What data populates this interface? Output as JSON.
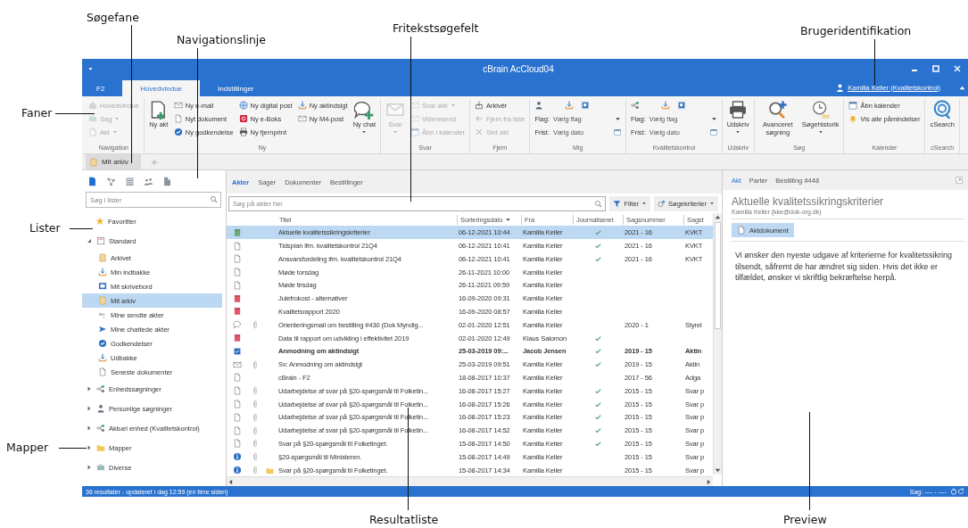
{
  "annotations": [
    {
      "label": "Søgefane"
    },
    {
      "label": "Navigationslinje"
    },
    {
      "label": "Fritekstsøgefelt"
    },
    {
      "label": "Brugeridentifikation"
    },
    {
      "label": "Faner"
    },
    {
      "label": "Lister"
    },
    {
      "label": "Mapper"
    },
    {
      "label": "Resultatliste"
    },
    {
      "label": "Preview"
    }
  ],
  "window": {
    "title": "cBrain AcCloud04"
  },
  "tabs": [
    {
      "label": "F2",
      "selected": false
    },
    {
      "label": "Hovedvindue",
      "selected": true
    },
    {
      "label": "Indstillinger",
      "selected": false
    }
  ],
  "user": {
    "label": "Kamilla Keller (Kvalitetskontrol)"
  },
  "ribbon": {
    "groups": [
      {
        "label": "Navigation",
        "columns": [
          [
            {
              "kind": "small",
              "label": "Hovedvindue",
              "disabled": true,
              "dropdown": false
            },
            {
              "kind": "small",
              "label": "Sag",
              "disabled": true,
              "dropdown": true
            },
            {
              "kind": "small",
              "label": "Akt",
              "disabled": true,
              "dropdown": true
            }
          ]
        ]
      },
      {
        "label": "Ny",
        "columns": [
          [
            {
              "kind": "large",
              "label": "Ny akt",
              "disabled": false,
              "dropdown": false
            }
          ],
          [
            {
              "kind": "small",
              "label": "Ny e-mail",
              "disabled": false,
              "dropdown": false
            },
            {
              "kind": "small",
              "label": "Nyt dokument",
              "disabled": false,
              "dropdown": false
            },
            {
              "kind": "small",
              "label": "Ny godkendelse",
              "disabled": false,
              "dropdown": false
            }
          ],
          [
            {
              "kind": "small",
              "label": "Ny digital post",
              "disabled": false,
              "dropdown": false
            },
            {
              "kind": "small",
              "label": "Ny e-Boks",
              "disabled": false,
              "dropdown": false
            },
            {
              "kind": "small",
              "label": "Ny fjernprint",
              "disabled": false,
              "dropdown": false
            }
          ],
          [
            {
              "kind": "small",
              "label": "Ny aktindsigt",
              "disabled": false,
              "dropdown": false
            },
            {
              "kind": "small",
              "label": "Ny M4-post",
              "disabled": false,
              "dropdown": false
            }
          ],
          [
            {
              "kind": "large",
              "label": "Ny chat",
              "disabled": false,
              "dropdown": true
            }
          ]
        ]
      },
      {
        "label": "Svar",
        "columns": [
          [
            {
              "kind": "large",
              "label": "Svar",
              "disabled": true,
              "dropdown": true
            }
          ],
          [
            {
              "kind": "small",
              "label": "Svar alle",
              "disabled": true,
              "dropdown": true
            },
            {
              "kind": "small",
              "label": "Videresend",
              "disabled": true,
              "dropdown": false
            },
            {
              "kind": "small",
              "label": "Åbn i kalender",
              "disabled": true,
              "dropdown": false
            }
          ]
        ]
      },
      {
        "label": "Fjern",
        "columns": [
          [
            {
              "kind": "small",
              "label": "Arkivér",
              "disabled": false,
              "dropdown": false
            },
            {
              "kind": "small",
              "label": "Fjern fra liste",
              "disabled": true,
              "dropdown": false
            },
            {
              "kind": "small",
              "label": "Slet akt",
              "disabled": true,
              "dropdown": false
            }
          ]
        ]
      },
      {
        "label": "Mig",
        "columns": [
          [
            {
              "kind": "icons"
            },
            {
              "kind": "dropdown-field",
              "label": "Flag:",
              "value": "Vælg flag"
            },
            {
              "kind": "date-field",
              "label": "Frist:",
              "value": "Vælg dato"
            }
          ]
        ]
      },
      {
        "label": "Kvalitetskontrol",
        "columns": [
          [
            {
              "kind": "icons"
            },
            {
              "kind": "dropdown-field",
              "label": "Flag:",
              "value": "Vælg flag"
            },
            {
              "kind": "date-field",
              "label": "Frist:",
              "value": "Vælg dato"
            }
          ]
        ]
      },
      {
        "label": "Udskriv",
        "columns": [
          [
            {
              "kind": "large",
              "label": "Udskriv",
              "disabled": false,
              "dropdown": true
            }
          ]
        ]
      },
      {
        "label": "Søg",
        "columns": [
          [
            {
              "kind": "large",
              "label": "Avanceret søgning",
              "disabled": false,
              "dropdown": false
            }
          ],
          [
            {
              "kind": "large",
              "label": "Søgehistorik",
              "disabled": false,
              "dropdown": true
            }
          ]
        ]
      },
      {
        "label": "Kalender",
        "columns": [
          [
            {
              "kind": "small",
              "label": "Åbn kalender",
              "disabled": false,
              "dropdown": false
            },
            {
              "kind": "small",
              "label": "Vis alle påmindelser",
              "disabled": false,
              "dropdown": false
            }
          ]
        ]
      },
      {
        "label": "cSearch",
        "columns": [
          [
            {
              "kind": "large",
              "label": "cSearch",
              "disabled": false,
              "dropdown": false
            }
          ]
        ]
      }
    ]
  },
  "doc_tabs": [
    {
      "label": "Mit arkiv",
      "selected": true
    }
  ],
  "sidebar": {
    "tools": [
      {
        "selected": true
      },
      {
        "selected": false
      },
      {
        "selected": false
      },
      {
        "selected": false
      },
      {
        "selected": false
      }
    ],
    "search": {
      "placeholder": "Søg i lister"
    },
    "items": [
      {
        "label": "Favoritter",
        "selected": false
      },
      {
        "label": "Standard",
        "selected": false,
        "expanded": true,
        "children": [
          {
            "label": "Arkivet",
            "selected": false
          },
          {
            "label": "Min indbakke",
            "selected": false
          },
          {
            "label": "Mit skrivebord",
            "selected": false
          },
          {
            "label": "Mit arkiv",
            "selected": true
          },
          {
            "label": "Mine sendte akter",
            "selected": false
          },
          {
            "label": "Mine chattede akter",
            "selected": false
          },
          {
            "label": "Godkendelser",
            "selected": false
          },
          {
            "label": "Udbakke",
            "selected": false
          },
          {
            "label": "Seneste dokumenter",
            "selected": false
          }
        ]
      },
      {
        "label": "Enhedssøgninger",
        "selected": false,
        "expanded": false
      },
      {
        "label": "Personlige søgninger",
        "selected": false,
        "expanded": false
      },
      {
        "label": "Aktuel enhed (Kvalitetskontrol)",
        "selected": false,
        "expanded": false
      },
      {
        "label": "Mapper",
        "selected": false,
        "expanded": false
      },
      {
        "label": "Diverse",
        "selected": false,
        "expanded": false
      }
    ]
  },
  "list": {
    "tabs": [
      {
        "label": "Akter",
        "selected": true
      },
      {
        "label": "Sager",
        "selected": false
      },
      {
        "label": "Dokumenter",
        "selected": false
      },
      {
        "label": "Bestillinger",
        "selected": false
      }
    ],
    "search": {
      "placeholder": "Søg på akter her"
    },
    "filter": "Filter",
    "criteria": "Søgekriterier",
    "columns": [
      {
        "label": "Titel",
        "sorted": false
      },
      {
        "label": "Sorteringsdato",
        "sorted": true
      },
      {
        "label": "Fra",
        "sorted": false
      },
      {
        "label": "Journaliseret",
        "sorted": false
      },
      {
        "label": "Sagsnummer",
        "sorted": false
      },
      {
        "label": "Sagst",
        "sorted": false
      }
    ],
    "rows": [
      {
        "kind": "note",
        "attachment": false,
        "folder": false,
        "title": "Aktuelle kvalitetssikringskriterier",
        "date": "06-12-2021 10:44",
        "from": "Kamilla Keller",
        "journalized": true,
        "case_number": "2021 - 16",
        "case_title": "KVKT",
        "bold": false,
        "selected": true
      },
      {
        "kind": "document",
        "attachment": false,
        "folder": false,
        "title": "Tidsplan ifm. kvalitetskontrol 21Q4",
        "date": "06-12-2021 10:41",
        "from": "Kamilla Keller",
        "journalized": true,
        "case_number": "2021 - 16",
        "case_title": "KVKT",
        "bold": false,
        "selected": false
      },
      {
        "kind": "document",
        "attachment": false,
        "folder": false,
        "title": "Ansvarsfordeling ifm. kvalitetskontrol 21Q4",
        "date": "06-12-2021 10:41",
        "from": "Kamilla Keller",
        "journalized": true,
        "case_number": "2021 - 16",
        "case_title": "KVKT",
        "bold": false,
        "selected": false
      },
      {
        "kind": "document",
        "attachment": false,
        "folder": false,
        "title": "Møde torsdag",
        "date": "26-11-2021 10:00",
        "from": "Kamilla Keller",
        "journalized": false,
        "bold": false,
        "selected": false
      },
      {
        "kind": "document",
        "attachment": false,
        "folder": false,
        "title": "Møde tirsdag",
        "date": "26-11-2021 09:59",
        "from": "Kamilla Keller",
        "journalized": false,
        "bold": false,
        "selected": false
      },
      {
        "kind": "calendar",
        "attachment": false,
        "folder": false,
        "title": "Julefrokost - alternativer",
        "date": "16-09-2020 09:31",
        "from": "Kamilla Keller",
        "journalized": false,
        "bold": false,
        "selected": false
      },
      {
        "kind": "calendar",
        "attachment": false,
        "folder": false,
        "title": "Kvalitetsrapport 2020",
        "date": "16-09-2020 08:57",
        "from": "Kamilla Keller",
        "journalized": false,
        "bold": false,
        "selected": false
      },
      {
        "kind": "chat",
        "attachment": true,
        "folder": false,
        "title": "Orienteringsmail om bestilling #430 (Dok Myndig...",
        "date": "02-01-2020 12:51",
        "from": "Kamilla Keller",
        "journalized": false,
        "case_number": "2020 - 1",
        "case_title": "Styrel",
        "bold": false,
        "selected": false
      },
      {
        "kind": "calendar",
        "attachment": false,
        "folder": false,
        "title": "Data til rapport om udvikling i effektivitet 2019",
        "date": "02-01-2020 12:49",
        "from": "Klaus Salomon",
        "journalized": true,
        "bold": false,
        "selected": false
      },
      {
        "kind": "task",
        "attachment": false,
        "folder": false,
        "title": "Anmodning om aktindsigt",
        "date": "25-03-2019 09:...",
        "from": "Jacob Jensen",
        "journalized": true,
        "case_number": "2019 - 15",
        "case_title": "Aktin",
        "bold": true,
        "selected": false
      },
      {
        "kind": "mail",
        "attachment": true,
        "folder": false,
        "title": "Sv: Anmodning om aktindsigt",
        "date": "25-03-2019 09:51",
        "from": "Kamilla Keller",
        "journalized": true,
        "case_number": "2019 - 15",
        "case_title": "Aktin",
        "bold": false,
        "selected": false
      },
      {
        "kind": "document",
        "attachment": false,
        "folder": false,
        "title": "cBrain - F2",
        "date": "18-08-2017 10:37",
        "from": "Kamilla Keller",
        "journalized": false,
        "case_number": "2017 - 56",
        "case_title": "Adga",
        "bold": false,
        "selected": false
      },
      {
        "kind": "document",
        "attachment": true,
        "folder": false,
        "title": "Udarbejdelse af svar på §20-spørgsmål til Folketin...",
        "date": "16-08-2017 15:27",
        "from": "Kamilla Keller",
        "journalized": true,
        "case_number": "2015 - 15",
        "case_title": "Svar p",
        "bold": false,
        "selected": false
      },
      {
        "kind": "document",
        "attachment": true,
        "folder": false,
        "title": "Udarbejdelse af svar på §20-spørgsmål til Folketin...",
        "date": "16-08-2017 15:26",
        "from": "Kamilla Keller",
        "journalized": true,
        "case_number": "2015 - 15",
        "case_title": "Svar p",
        "bold": false,
        "selected": false
      },
      {
        "kind": "document",
        "attachment": true,
        "folder": false,
        "title": "Udarbejdelse af svar på §20-spørgsmål til Folketin...",
        "date": "16-08-2017 15:23",
        "from": "Kamilla Keller",
        "journalized": true,
        "case_number": "2015 - 15",
        "case_title": "Svar p",
        "bold": false,
        "selected": false
      },
      {
        "kind": "document",
        "attachment": true,
        "folder": false,
        "title": "Udarbejdelse af svar på §20-spørgsmål til Folketin...",
        "date": "16-08-2017 14:52",
        "from": "Kamilla Keller",
        "journalized": true,
        "case_number": "2015 - 15",
        "case_title": "Svar p",
        "bold": false,
        "selected": false
      },
      {
        "kind": "document",
        "attachment": true,
        "folder": false,
        "title": "Svar på §20-spørgsmål til Folketinget.",
        "date": "15-08-2017 14:50",
        "from": "Kamilla Keller",
        "journalized": true,
        "case_number": "2015 - 15",
        "case_title": "Svar p",
        "bold": false,
        "selected": false
      },
      {
        "kind": "info",
        "attachment": true,
        "folder": false,
        "title": "§20-spørgsmål til Ministeren.",
        "date": "15-08-2017 14:49",
        "from": "Kamilla Keller",
        "journalized": false,
        "case_number": "2015 - 15",
        "case_title": "Svar p",
        "bold": false,
        "selected": false
      },
      {
        "kind": "info",
        "attachment": true,
        "folder": true,
        "title": "Svar på §20-spørgsmål til Folketinget.",
        "date": "15-08-2017 14:34",
        "from": "Kamilla Keller",
        "journalized": false,
        "case_number": "2015 - 15",
        "case_title": "Svar p",
        "bold": false,
        "selected": false
      }
    ]
  },
  "preview": {
    "tabs": [
      {
        "label": "Akt",
        "selected": true
      },
      {
        "label": "Parter",
        "selected": false
      },
      {
        "label": "Bestilling #448",
        "selected": false
      }
    ],
    "title": "Aktuelle kvalitetssikringskriterier",
    "sender": "Kamilla Keller (kke@dok-org.dk)",
    "attachments": [
      {
        "label": "Aktdokument",
        "selected": true
      }
    ],
    "body": "Vi ønsker den nyeste udgave af kriterierne for kvalitetssikring tilsendt, såfremt de har ændret sig siden. Hvis det ikke er tilfældet, ønsker vi skriftlig bekræftelse herpå."
  },
  "status_bar": {
    "left": "36 resultater - opdateret i dag 12:59 (en time siden)",
    "right": "Sag: ---- - ----"
  }
}
